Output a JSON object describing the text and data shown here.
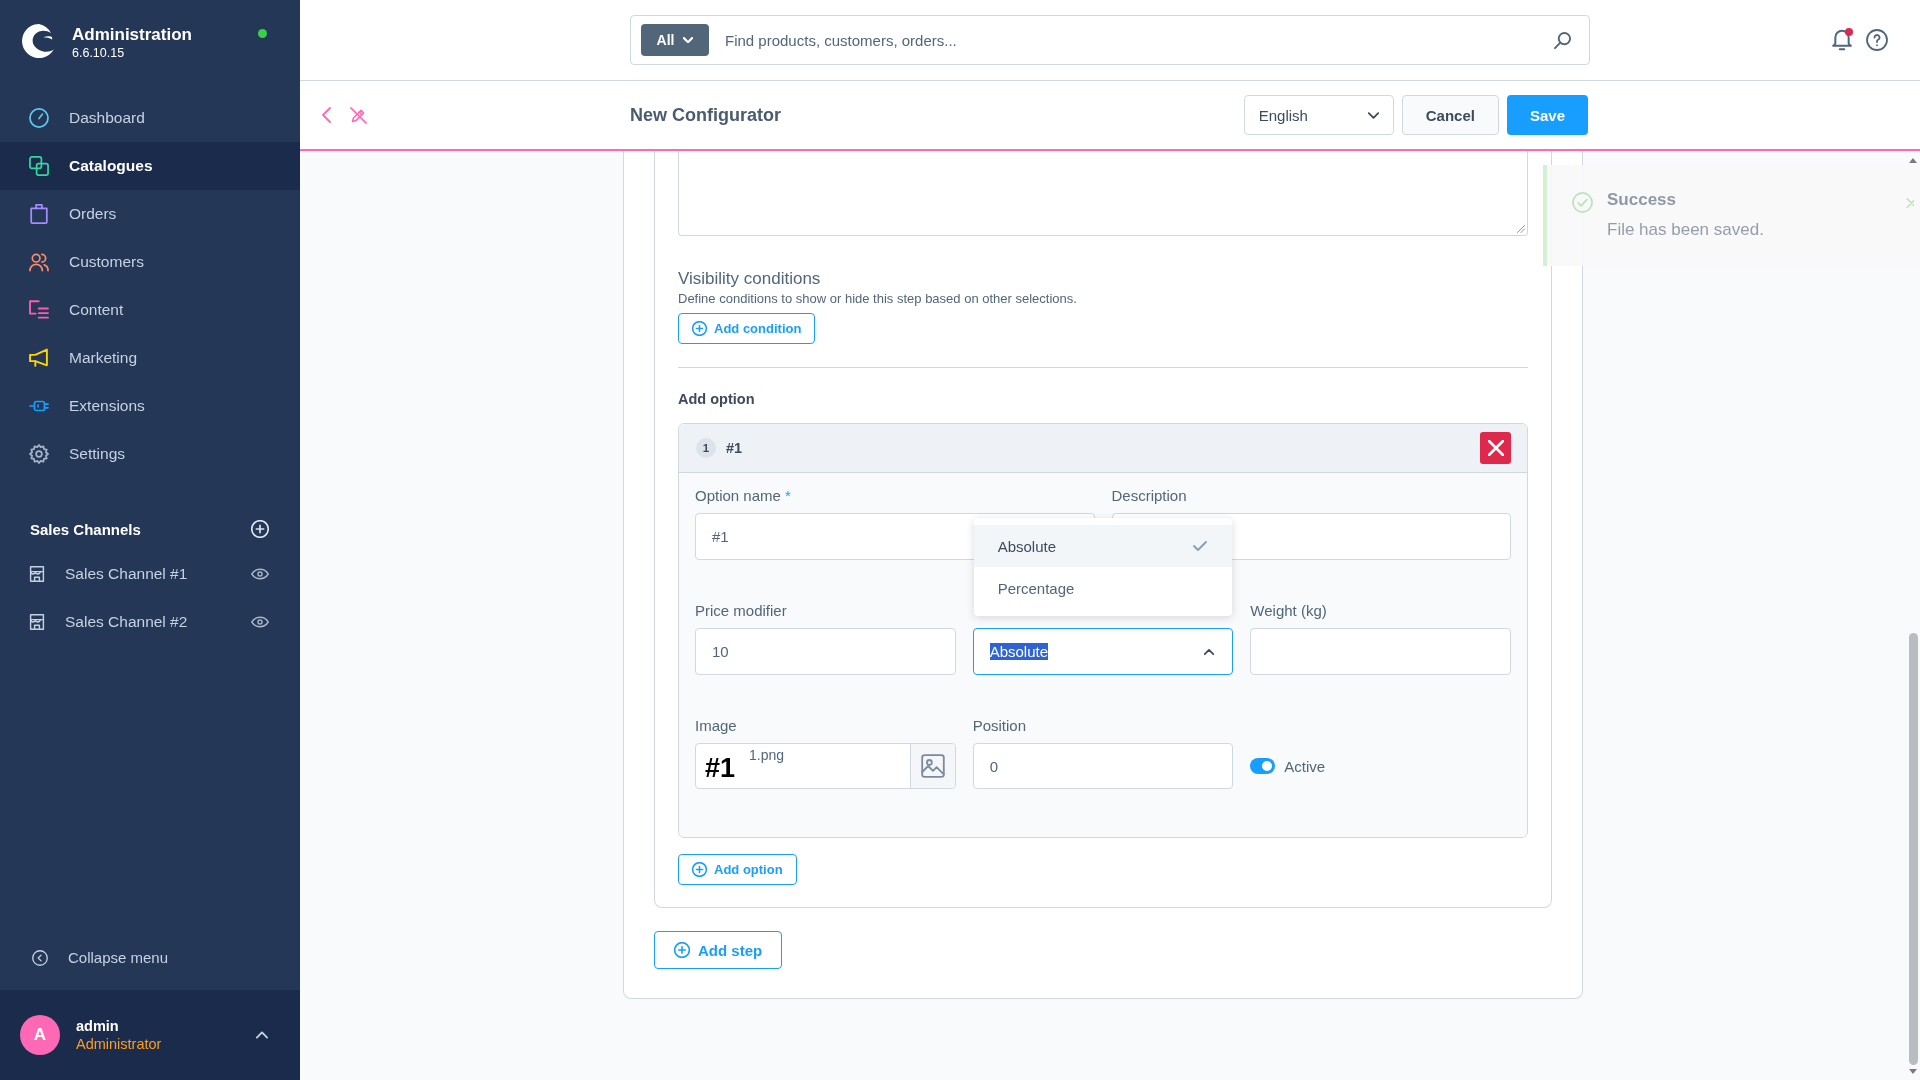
{
  "sidebar": {
    "app_name": "Administration",
    "version": "6.6.10.15",
    "online": true,
    "nav": [
      {
        "label": "Dashboard",
        "selected": false
      },
      {
        "label": "Catalogues",
        "selected": true
      },
      {
        "label": "Orders",
        "selected": false
      },
      {
        "label": "Customers",
        "selected": false
      },
      {
        "label": "Content",
        "selected": false
      },
      {
        "label": "Marketing",
        "selected": false
      },
      {
        "label": "Extensions",
        "selected": false
      },
      {
        "label": "Settings",
        "selected": false
      }
    ],
    "sales_channels": {
      "title": "Sales Channels",
      "items": [
        {
          "label": "Sales Channel #1"
        },
        {
          "label": "Sales Channel #2"
        }
      ]
    },
    "collapse_menu": "Collapse menu",
    "user": {
      "initial": "A",
      "name": "admin",
      "role": "Administrator"
    }
  },
  "top_bar": {
    "search": {
      "scope": "All",
      "placeholder": "Find products, customers, orders..."
    },
    "notifications_unread": true
  },
  "header": {
    "title": "New Configurator",
    "language": "English",
    "cancel": "Cancel",
    "save": "Save"
  },
  "step": {
    "visibility": {
      "title": "Visibility conditions",
      "description": "Define conditions to show or hide this step based on other selections.",
      "add_button": "Add condition"
    },
    "options_heading": "Add option",
    "options": [
      {
        "number": "1",
        "title": "#1",
        "option_name": {
          "label": "Option name",
          "required_mark": "*",
          "value": "#1"
        },
        "description": {
          "label": "Description"
        },
        "price_modifier": {
          "label": "Price modifier",
          "value": "10"
        },
        "type": {
          "value": "Absolute",
          "open": true,
          "choices": [
            {
              "label": "Absolute",
              "selected": true
            },
            {
              "label": "Percentage",
              "selected": false
            }
          ]
        },
        "weight": {
          "label": "Weight (kg)"
        },
        "image": {
          "label": "Image",
          "preview_text": "#1",
          "file_name": "1.png"
        },
        "position": {
          "label": "Position",
          "value": "0"
        },
        "active": {
          "label": "Active",
          "on": true
        }
      }
    ],
    "add_option_button": "Add option"
  },
  "add_step_button": "Add step",
  "toast": {
    "title": "Success",
    "message": "File has been saved."
  }
}
